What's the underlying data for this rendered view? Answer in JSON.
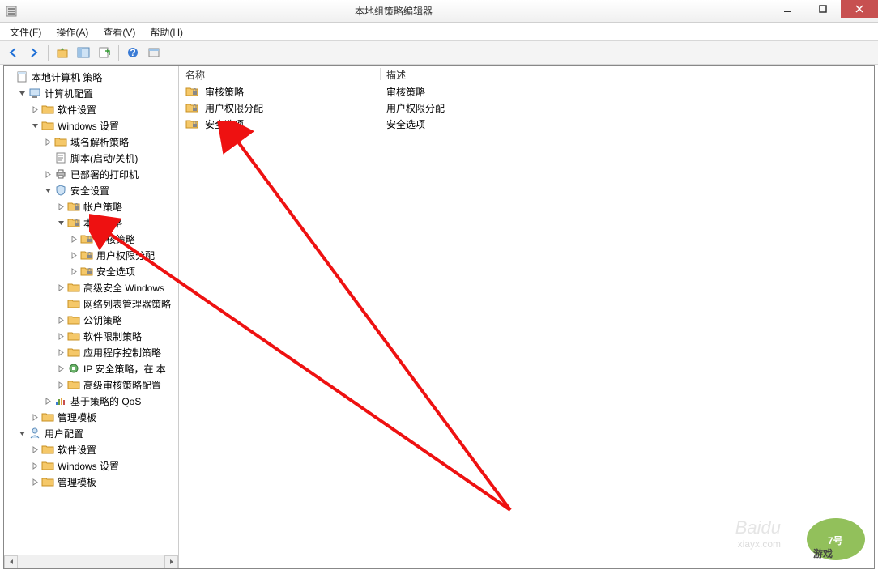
{
  "window": {
    "title": "本地组策略编辑器"
  },
  "menubar": {
    "file": "文件(F)",
    "action": "操作(A)",
    "view": "查看(V)",
    "help": "帮助(H)"
  },
  "toolbar": {
    "back": "back",
    "forward": "forward",
    "up": "up",
    "show_hide": "show-hide",
    "export": "export",
    "refresh": "refresh",
    "help": "help",
    "props": "properties"
  },
  "tree": {
    "root": {
      "label": "本地计算机 策略",
      "children": [
        {
          "id": "computer_cfg",
          "label": "计算机配置",
          "expanded": true,
          "icon": "computer",
          "children": [
            {
              "id": "sw_settings1",
              "label": "软件设置",
              "icon": "folder",
              "expandable": true
            },
            {
              "id": "win_settings1",
              "label": "Windows 设置",
              "icon": "folder",
              "expanded": true,
              "children": [
                {
                  "id": "dns_policy",
                  "label": "域名解析策略",
                  "icon": "folder",
                  "expandable": true
                },
                {
                  "id": "scripts",
                  "label": "脚本(启动/关机)",
                  "icon": "script"
                },
                {
                  "id": "printers",
                  "label": "已部署的打印机",
                  "icon": "printer",
                  "expandable": true
                },
                {
                  "id": "sec_settings",
                  "label": "安全设置",
                  "icon": "security",
                  "expanded": true,
                  "children": [
                    {
                      "id": "account_pol",
                      "label": "帐户策略",
                      "icon": "folder-lock",
                      "expandable": true
                    },
                    {
                      "id": "local_pol",
                      "label": "本地策略",
                      "icon": "folder-lock",
                      "expanded": true,
                      "children": [
                        {
                          "id": "audit_pol",
                          "label": "审核策略",
                          "icon": "folder-lock",
                          "expandable": true
                        },
                        {
                          "id": "user_rights",
                          "label": "用户权限分配",
                          "icon": "folder-lock",
                          "expandable": true
                        },
                        {
                          "id": "sec_options",
                          "label": "安全选项",
                          "icon": "folder-lock",
                          "expandable": true
                        }
                      ]
                    },
                    {
                      "id": "adv_win_fw",
                      "label": "高级安全 Windows",
                      "icon": "folder",
                      "expandable": true
                    },
                    {
                      "id": "netlist_mgr",
                      "label": "网络列表管理器策略",
                      "icon": "folder"
                    },
                    {
                      "id": "pubkey_pol",
                      "label": "公钥策略",
                      "icon": "folder",
                      "expandable": true
                    },
                    {
                      "id": "sw_restrict",
                      "label": "软件限制策略",
                      "icon": "folder",
                      "expandable": true
                    },
                    {
                      "id": "app_ctrl",
                      "label": "应用程序控制策略",
                      "icon": "folder",
                      "expandable": true
                    },
                    {
                      "id": "ipsec_pol",
                      "label": "IP 安全策略，在 本",
                      "icon": "ipsec",
                      "expandable": true
                    },
                    {
                      "id": "adv_audit",
                      "label": "高级审核策略配置",
                      "icon": "folder",
                      "expandable": true
                    }
                  ]
                },
                {
                  "id": "qos_policy",
                  "label": "基于策略的 QoS",
                  "icon": "qos",
                  "expandable": true
                }
              ]
            },
            {
              "id": "admin_tpl1",
              "label": "管理模板",
              "icon": "folder",
              "expandable": true
            }
          ]
        },
        {
          "id": "user_cfg",
          "label": "用户配置",
          "expanded": true,
          "icon": "user",
          "children": [
            {
              "id": "sw_settings2",
              "label": "软件设置",
              "icon": "folder",
              "expandable": true
            },
            {
              "id": "win_settings2",
              "label": "Windows 设置",
              "icon": "folder",
              "expandable": true
            },
            {
              "id": "admin_tpl2",
              "label": "管理模板",
              "icon": "folder",
              "expandable": true
            }
          ]
        }
      ]
    }
  },
  "list": {
    "columns": {
      "name": "名称",
      "description": "描述"
    },
    "rows": [
      {
        "name": "审核策略",
        "description": "审核策略",
        "icon": "folder-lock"
      },
      {
        "name": "用户权限分配",
        "description": "用户权限分配",
        "icon": "folder-lock"
      },
      {
        "name": "安全选项",
        "description": "安全选项",
        "icon": "folder-lock"
      }
    ]
  },
  "watermark": {
    "line1": "xiayx.com",
    "line2": "7号游戏"
  }
}
